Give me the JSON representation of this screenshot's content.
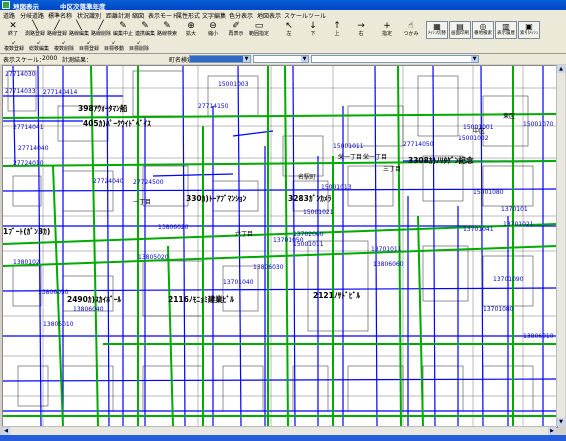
{
  "window": {
    "title": "地図表示",
    "subtitle": "中区次落準年度"
  },
  "menu": [
    "道路",
    "分岐道路",
    "標準名称",
    "状況識別",
    "距離計測",
    "縮図",
    "表示モード",
    "属性形式",
    "文字編集",
    "色分表示",
    "地図表示",
    "スケール",
    "ツール"
  ],
  "toolbar": {
    "row1": [
      {
        "icon": "exit-icon",
        "glyph": "✕",
        "label": "終了"
      },
      {
        "icon": "line-icon",
        "glyph": "╲",
        "label": "測路登録"
      },
      {
        "icon": "line-icon",
        "glyph": "╱",
        "label": "路線登録"
      },
      {
        "icon": "line-icon",
        "glyph": "╲",
        "label": "路線編集"
      },
      {
        "icon": "line-icon",
        "glyph": "╱",
        "label": "路線削除"
      },
      {
        "icon": "edit-icon",
        "glyph": "✎",
        "label": "編集中止"
      },
      {
        "icon": "edit-icon",
        "glyph": "✎",
        "label": "連携編集"
      },
      {
        "icon": "edit-icon",
        "glyph": "✎",
        "label": "路線検索"
      },
      {
        "icon": "zoom-in-icon",
        "glyph": "⊕",
        "label": "拡大"
      },
      {
        "icon": "zoom-out-icon",
        "glyph": "⊖",
        "label": "縮小"
      },
      {
        "icon": "redraw-icon",
        "glyph": "✐",
        "label": "再表示"
      },
      {
        "icon": "range-icon",
        "glyph": "▭",
        "label": "範囲指定"
      },
      {
        "icon": "arrow-left-icon",
        "glyph": "↖",
        "label": "左"
      },
      {
        "icon": "arrow-down-icon",
        "glyph": "↓",
        "label": "下"
      },
      {
        "icon": "arrow-up-icon",
        "glyph": "↑",
        "label": "上"
      },
      {
        "icon": "arrow-right-icon",
        "glyph": "→",
        "label": "右"
      },
      {
        "icon": "crosshair-icon",
        "glyph": "+",
        "label": "指定"
      },
      {
        "icon": "grab-icon",
        "glyph": "☝",
        "label": "つかみ"
      }
    ],
    "row1_boxed": [
      {
        "icon": "layer-icon",
        "glyph": "▦",
        "label": "ﾒｯｼｭ切替"
      },
      {
        "icon": "print-icon",
        "glyph": "▤",
        "label": "画面印刷"
      },
      {
        "icon": "search-icon",
        "glyph": "◎",
        "label": "番地検索"
      },
      {
        "icon": "history-icon",
        "glyph": "▥",
        "label": "表示履歴"
      },
      {
        "icon": "mesh-icon",
        "glyph": "▣",
        "label": "索引ﾒｯｼｭ"
      }
    ],
    "row2": [
      {
        "icon": "register-icon",
        "label": "複数登録"
      },
      {
        "icon": "register-icon",
        "label": "総数編集"
      },
      {
        "icon": "register-icon",
        "label": "複数削除"
      },
      {
        "icon": "register-icon",
        "label": "目標登録"
      },
      {
        "icon": "register-icon",
        "label": "目標移動"
      },
      {
        "icon": "register-icon",
        "label": "目標削除"
      }
    ],
    "cmd_button": "cmdTest"
  },
  "status": {
    "scale_label": "表示スケール：",
    "scale_value": "2000",
    "plan_label": "計測結果：",
    "town_label": "町名検索"
  },
  "map": {
    "buildings": [
      {
        "label": "398ｱｳｫｰﾀﾏﾝ船"
      },
      {
        "label": "405ｶ)ﾊﾟｰｸｳｲﾄﾞﾍﾞｲｽ"
      },
      {
        "label": "330ｶ)ﾄｰｱﾌﾞﾏﾝｼｮﾝ"
      },
      {
        "label": "3283ｶﾞﾝｶﾒﾗ"
      },
      {
        "label": "3308ｶ)ﾉﾘﾀｹﾞﾝ記念"
      },
      {
        "label": "1ﾌﾞｰﾄ(ｶﾞﾝ3ｶ)"
      },
      {
        "label": "2490ｶ)ｽｶｲﾎﾞｰﾙ"
      },
      {
        "label": "2116ﾉﾓﾆｮﾐ建業ﾋﾞﾙ"
      },
      {
        "label": "2121ﾉｻﾄﾞﾋﾞﾙ"
      }
    ],
    "road_ids": [
      "27714030",
      "27714033",
      "277140414",
      "27714041",
      "15001001",
      "27714040",
      "27724010",
      "27714050",
      "15001003",
      "27714150",
      "15001011",
      "15001002",
      "15001070",
      "27724040",
      "15001013",
      "15001021",
      "15001080",
      "13702060",
      "27724500",
      "15001011",
      "13701011",
      "13701041",
      "13701021",
      "13701050",
      "1370101",
      "13806020",
      "1380102",
      "13805020",
      "13806030",
      "13806050",
      "13701040",
      "13806040",
      "13805010",
      "13806060",
      "13701090",
      "13701080",
      "13806010"
    ],
    "place_labels": [
      "中区",
      "栄一丁目",
      "名駅町",
      "三丁目",
      "一丁目",
      "東区",
      "栄一丁目",
      "六丁目"
    ]
  },
  "colors": {
    "major_road": "#00aa00",
    "minor_road": "#0000ff",
    "road_id": "#0000c8",
    "label": "#000000",
    "titlebar": "#0a5fd8"
  }
}
